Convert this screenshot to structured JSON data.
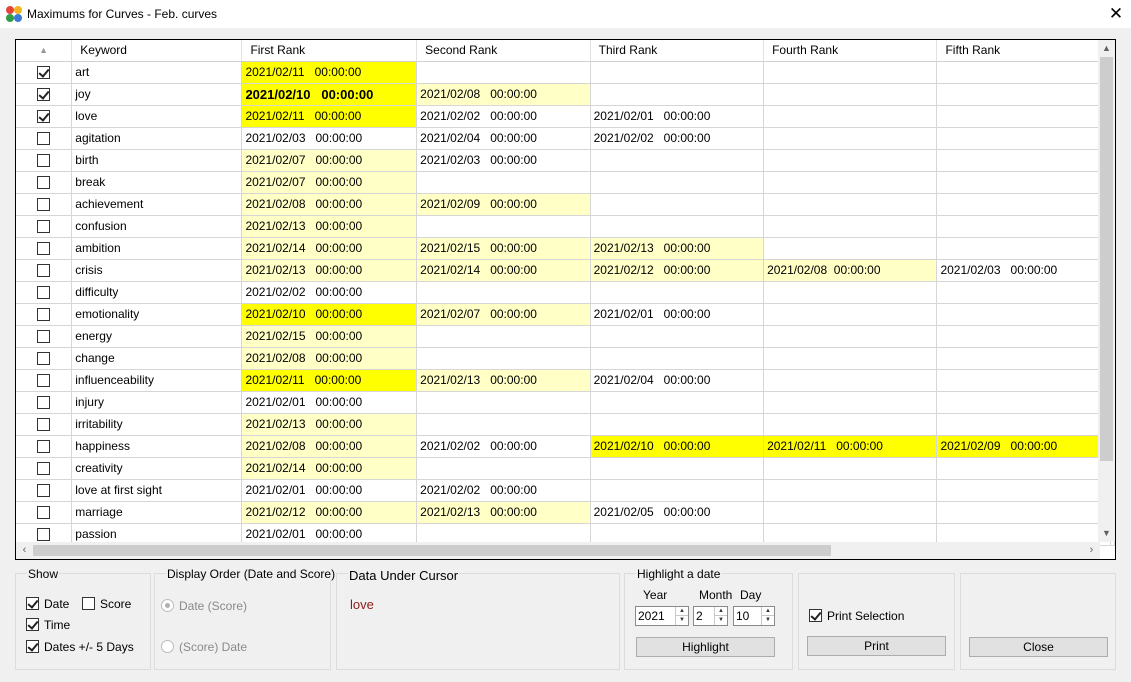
{
  "window": {
    "title": "Maximums for Curves - Feb. curves",
    "close_glyph": "✕",
    "icon": "app-flower-icon"
  },
  "grid": {
    "sort_indicator": "▲",
    "columns": [
      "Keyword",
      "First Rank",
      "Second Rank",
      "Third Rank",
      "Fourth Rank",
      "Fifth Rank"
    ],
    "rows": [
      {
        "checked": true,
        "keyword": "art",
        "ranks": [
          {
            "text": "2021/02/11   00:00:00",
            "hl": "strong"
          },
          {
            "text": "",
            "hl": ""
          },
          {
            "text": "",
            "hl": ""
          },
          {
            "text": "",
            "hl": ""
          },
          {
            "text": "",
            "hl": ""
          }
        ]
      },
      {
        "checked": true,
        "keyword": "joy",
        "ranks": [
          {
            "text": "2021/02/10   00:00:00",
            "hl": "strong",
            "bold": true
          },
          {
            "text": "2021/02/08   00:00:00",
            "hl": "light"
          },
          {
            "text": "",
            "hl": ""
          },
          {
            "text": "",
            "hl": ""
          },
          {
            "text": "",
            "hl": ""
          }
        ]
      },
      {
        "checked": true,
        "keyword": "love",
        "ranks": [
          {
            "text": "2021/02/11   00:00:00",
            "hl": "strong"
          },
          {
            "text": "2021/02/02   00:00:00",
            "hl": ""
          },
          {
            "text": "2021/02/01   00:00:00",
            "hl": ""
          },
          {
            "text": "",
            "hl": ""
          },
          {
            "text": "",
            "hl": ""
          }
        ]
      },
      {
        "checked": false,
        "keyword": "agitation",
        "ranks": [
          {
            "text": "2021/02/03   00:00:00",
            "hl": ""
          },
          {
            "text": "2021/02/04   00:00:00",
            "hl": ""
          },
          {
            "text": "2021/02/02   00:00:00",
            "hl": ""
          },
          {
            "text": "",
            "hl": ""
          },
          {
            "text": "",
            "hl": ""
          }
        ]
      },
      {
        "checked": false,
        "keyword": "birth",
        "ranks": [
          {
            "text": "2021/02/07   00:00:00",
            "hl": "light"
          },
          {
            "text": "2021/02/03   00:00:00",
            "hl": ""
          },
          {
            "text": "",
            "hl": ""
          },
          {
            "text": "",
            "hl": ""
          },
          {
            "text": "",
            "hl": ""
          }
        ]
      },
      {
        "checked": false,
        "keyword": "break",
        "ranks": [
          {
            "text": "2021/02/07   00:00:00",
            "hl": "light"
          },
          {
            "text": "",
            "hl": ""
          },
          {
            "text": "",
            "hl": ""
          },
          {
            "text": "",
            "hl": ""
          },
          {
            "text": "",
            "hl": ""
          }
        ]
      },
      {
        "checked": false,
        "keyword": "achievement",
        "ranks": [
          {
            "text": "2021/02/08   00:00:00",
            "hl": "light"
          },
          {
            "text": "2021/02/09   00:00:00",
            "hl": "light"
          },
          {
            "text": "",
            "hl": ""
          },
          {
            "text": "",
            "hl": ""
          },
          {
            "text": "",
            "hl": ""
          }
        ]
      },
      {
        "checked": false,
        "keyword": "confusion",
        "ranks": [
          {
            "text": "2021/02/13   00:00:00",
            "hl": "light"
          },
          {
            "text": "",
            "hl": ""
          },
          {
            "text": "",
            "hl": ""
          },
          {
            "text": "",
            "hl": ""
          },
          {
            "text": "",
            "hl": ""
          }
        ]
      },
      {
        "checked": false,
        "keyword": "ambition",
        "ranks": [
          {
            "text": "2021/02/14   00:00:00",
            "hl": "light"
          },
          {
            "text": "2021/02/15   00:00:00",
            "hl": "light"
          },
          {
            "text": "2021/02/13   00:00:00",
            "hl": "light"
          },
          {
            "text": "",
            "hl": ""
          },
          {
            "text": "",
            "hl": ""
          }
        ]
      },
      {
        "checked": false,
        "keyword": "crisis",
        "ranks": [
          {
            "text": "2021/02/13   00:00:00",
            "hl": "light"
          },
          {
            "text": "2021/02/14   00:00:00",
            "hl": "light"
          },
          {
            "text": "2021/02/12   00:00:00",
            "hl": "light"
          },
          {
            "text": "2021/02/08  00:00:00",
            "hl": "light"
          },
          {
            "text": "2021/02/03   00:00:00",
            "hl": ""
          }
        ]
      },
      {
        "checked": false,
        "keyword": "difficulty",
        "ranks": [
          {
            "text": "2021/02/02   00:00:00",
            "hl": ""
          },
          {
            "text": "",
            "hl": ""
          },
          {
            "text": "",
            "hl": ""
          },
          {
            "text": "",
            "hl": ""
          },
          {
            "text": "",
            "hl": ""
          }
        ]
      },
      {
        "checked": false,
        "keyword": "emotionality",
        "ranks": [
          {
            "text": "2021/02/10   00:00:00",
            "hl": "strong"
          },
          {
            "text": "2021/02/07   00:00:00",
            "hl": "light"
          },
          {
            "text": "2021/02/01   00:00:00",
            "hl": ""
          },
          {
            "text": "",
            "hl": ""
          },
          {
            "text": "",
            "hl": ""
          }
        ]
      },
      {
        "checked": false,
        "keyword": "energy",
        "ranks": [
          {
            "text": "2021/02/15   00:00:00",
            "hl": "light"
          },
          {
            "text": "",
            "hl": ""
          },
          {
            "text": "",
            "hl": ""
          },
          {
            "text": "",
            "hl": ""
          },
          {
            "text": "",
            "hl": ""
          }
        ]
      },
      {
        "checked": false,
        "keyword": "change",
        "ranks": [
          {
            "text": "2021/02/08   00:00:00",
            "hl": "light"
          },
          {
            "text": "",
            "hl": ""
          },
          {
            "text": "",
            "hl": ""
          },
          {
            "text": "",
            "hl": ""
          },
          {
            "text": "",
            "hl": ""
          }
        ]
      },
      {
        "checked": false,
        "keyword": "influenceability",
        "ranks": [
          {
            "text": "2021/02/11   00:00:00",
            "hl": "strong"
          },
          {
            "text": "2021/02/13   00:00:00",
            "hl": "light"
          },
          {
            "text": "2021/02/04   00:00:00",
            "hl": ""
          },
          {
            "text": "",
            "hl": ""
          },
          {
            "text": "",
            "hl": ""
          }
        ]
      },
      {
        "checked": false,
        "keyword": "injury",
        "ranks": [
          {
            "text": "2021/02/01   00:00:00",
            "hl": ""
          },
          {
            "text": "",
            "hl": ""
          },
          {
            "text": "",
            "hl": ""
          },
          {
            "text": "",
            "hl": ""
          },
          {
            "text": "",
            "hl": ""
          }
        ]
      },
      {
        "checked": false,
        "keyword": "irritability",
        "ranks": [
          {
            "text": "2021/02/13   00:00:00",
            "hl": "light"
          },
          {
            "text": "",
            "hl": ""
          },
          {
            "text": "",
            "hl": ""
          },
          {
            "text": "",
            "hl": ""
          },
          {
            "text": "",
            "hl": ""
          }
        ]
      },
      {
        "checked": false,
        "keyword": "happiness",
        "ranks": [
          {
            "text": "2021/02/08   00:00:00",
            "hl": "light"
          },
          {
            "text": "2021/02/02   00:00:00",
            "hl": ""
          },
          {
            "text": "2021/02/10   00:00:00",
            "hl": "strong"
          },
          {
            "text": "2021/02/11   00:00:00",
            "hl": "strong"
          },
          {
            "text": "2021/02/09   00:00:00",
            "hl": "strong"
          }
        ]
      },
      {
        "checked": false,
        "keyword": "creativity",
        "ranks": [
          {
            "text": "2021/02/14   00:00:00",
            "hl": "light"
          },
          {
            "text": "",
            "hl": ""
          },
          {
            "text": "",
            "hl": ""
          },
          {
            "text": "",
            "hl": ""
          },
          {
            "text": "",
            "hl": ""
          }
        ]
      },
      {
        "checked": false,
        "keyword": "love at first sight",
        "ranks": [
          {
            "text": "2021/02/01   00:00:00",
            "hl": ""
          },
          {
            "text": "2021/02/02   00:00:00",
            "hl": ""
          },
          {
            "text": "",
            "hl": ""
          },
          {
            "text": "",
            "hl": ""
          },
          {
            "text": "",
            "hl": ""
          }
        ]
      },
      {
        "checked": false,
        "keyword": "marriage",
        "ranks": [
          {
            "text": "2021/02/12   00:00:00",
            "hl": "light"
          },
          {
            "text": "2021/02/13   00:00:00",
            "hl": "light"
          },
          {
            "text": "2021/02/05   00:00:00",
            "hl": ""
          },
          {
            "text": "",
            "hl": ""
          },
          {
            "text": "",
            "hl": ""
          }
        ]
      },
      {
        "checked": false,
        "keyword": "passion",
        "ranks": [
          {
            "text": "2021/02/01   00:00:00",
            "hl": ""
          },
          {
            "text": "",
            "hl": ""
          },
          {
            "text": "",
            "hl": ""
          },
          {
            "text": "",
            "hl": ""
          },
          {
            "text": "",
            "hl": ""
          }
        ]
      }
    ],
    "colors": {
      "strong": "#ffff00",
      "light": "#ffffc6"
    }
  },
  "show": {
    "title": "Show",
    "date": {
      "label": "Date",
      "checked": true
    },
    "score": {
      "label": "Score",
      "checked": false
    },
    "time": {
      "label": "Time",
      "checked": true
    },
    "dates_pm": {
      "label": "Dates +/- 5 Days",
      "checked": true
    }
  },
  "display_order": {
    "title": "Display Order (Date and Score)",
    "opt1": {
      "label": "Date (Score)",
      "selected": true
    },
    "opt2": {
      "label": "(Score) Date",
      "selected": false
    }
  },
  "data_under_cursor": {
    "title": "Data Under Cursor",
    "value": "love"
  },
  "highlight": {
    "title": "Highlight a date",
    "year_label": "Year",
    "month_label": "Month",
    "day_label": "Day",
    "year": "2021",
    "month": "2",
    "day": "10",
    "button": "Highlight"
  },
  "print": {
    "print_selection_label": "Print Selection",
    "print_selection_checked": true,
    "button": "Print"
  },
  "close_button": "Close"
}
